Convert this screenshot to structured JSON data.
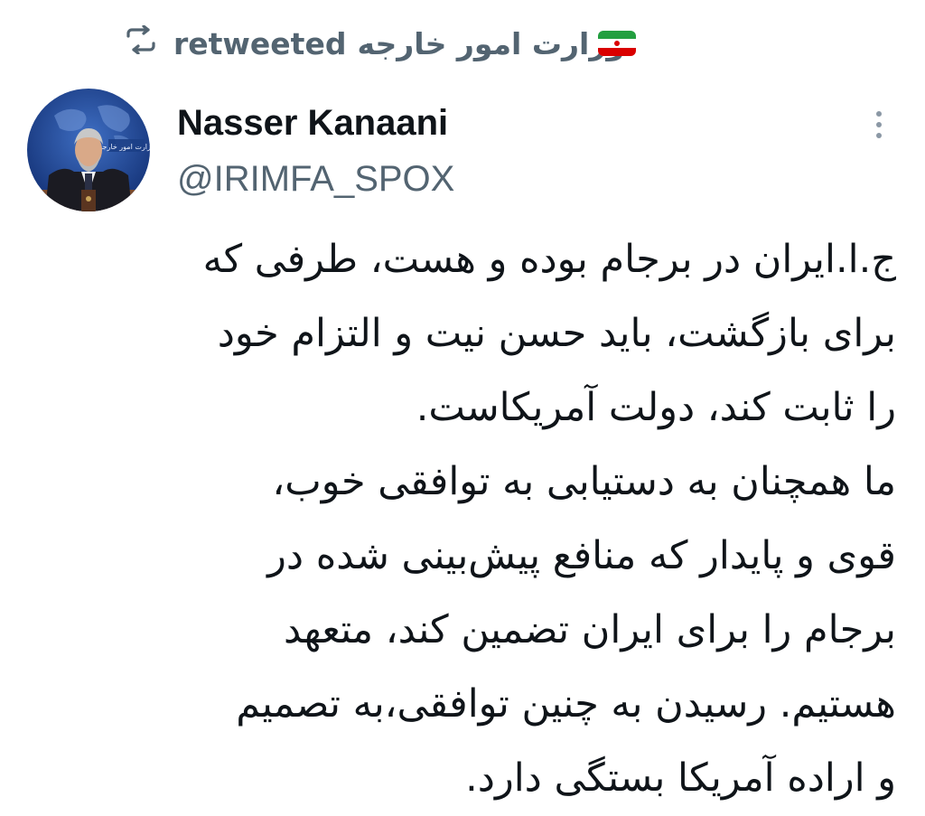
{
  "retweet": {
    "label": "retweeted",
    "account": "وزارت امور خارجه",
    "flag_colors": [
      "#239f40",
      "#ffffff",
      "#da0000"
    ]
  },
  "author": {
    "name": "Nasser Kanaani",
    "handle": "@IRIMFA_SPOX"
  },
  "icons": {
    "retweet": "retweet-icon",
    "more": "more-vertical-icon",
    "flag": "iran-flag-icon"
  },
  "tweet": {
    "lines": [
      "ج.ا.ایران در برجام بوده و هست، طرفی که",
      "برای بازگشت، باید حسن نیت و التزام خود",
      "را ثابت کند، دولت آمریکاست.",
      "ما همچنان به دستیابی به توافقی خوب،",
      "قوی و پایدار که منافع پیش‌بینی شده در",
      "برجام را برای ایران تضمین کند، متعهد",
      "هستیم. رسیدن به چنین توافقی،به تصمیم",
      "و اراده آمریکا بستگی دارد."
    ]
  },
  "colors": {
    "text_primary": "#0f1419",
    "text_secondary": "#536471",
    "background": "#ffffff"
  }
}
